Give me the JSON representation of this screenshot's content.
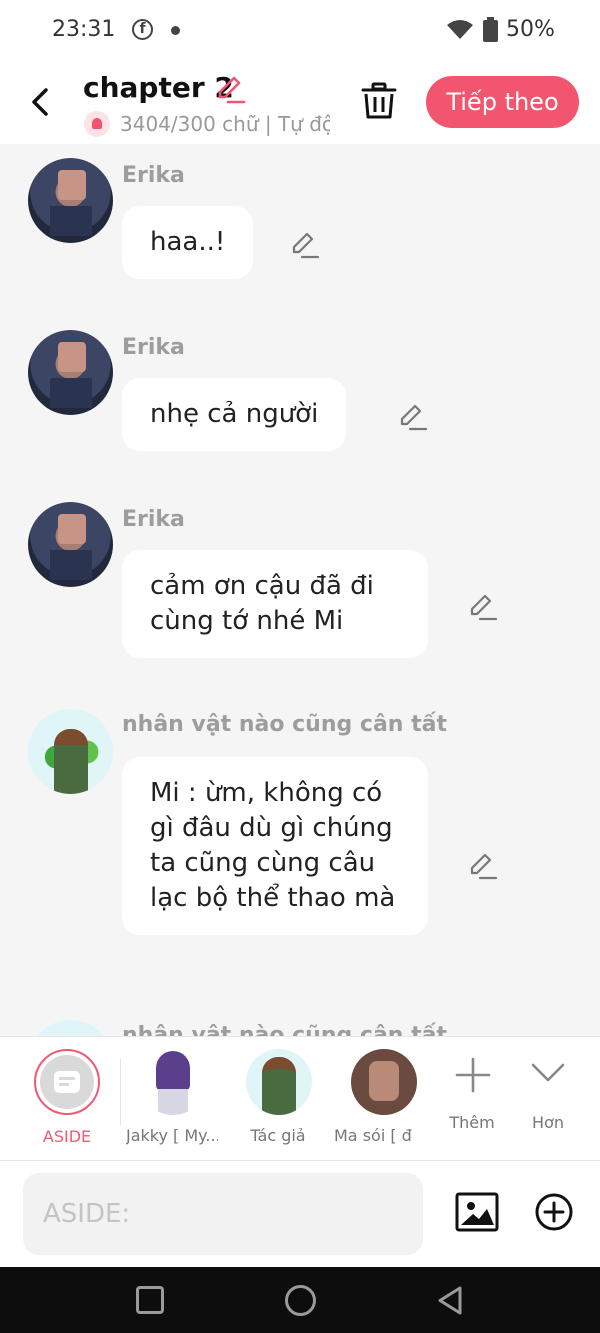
{
  "status_bar": {
    "time": "23:31",
    "battery": "50%"
  },
  "header": {
    "title": "chapter 2",
    "word_count": "3404/300 chữ | Tự độ",
    "next_button": "Tiếp theo"
  },
  "messages": [
    {
      "sender": "Erika",
      "text": "haa..!"
    },
    {
      "sender": "Erika",
      "text": "nhẹ cả người"
    },
    {
      "sender": "Erika",
      "text": "cảm ơn cậu đã đi cùng tớ nhé Mi"
    },
    {
      "sender": "nhân vật nào cũng cân tất",
      "text": "Mi : ừm, không có gì đâu dù gì chúng ta cũng cùng câu lạc bộ thể thao mà"
    },
    {
      "sender": "nhân vật nào cũng cân tất"
    }
  ],
  "tray": {
    "aside_label": "ASIDE",
    "characters": [
      "Jakky [ My...",
      "Tác giả",
      "Ma sói [ đ"
    ],
    "more_label": "Thêm",
    "expand_label": "Hơn"
  },
  "input": {
    "placeholder": "ASIDE:"
  },
  "colors": {
    "accent": "#f2566f",
    "sender_text": "#9d9d9d",
    "background": "#f5f5f5"
  }
}
